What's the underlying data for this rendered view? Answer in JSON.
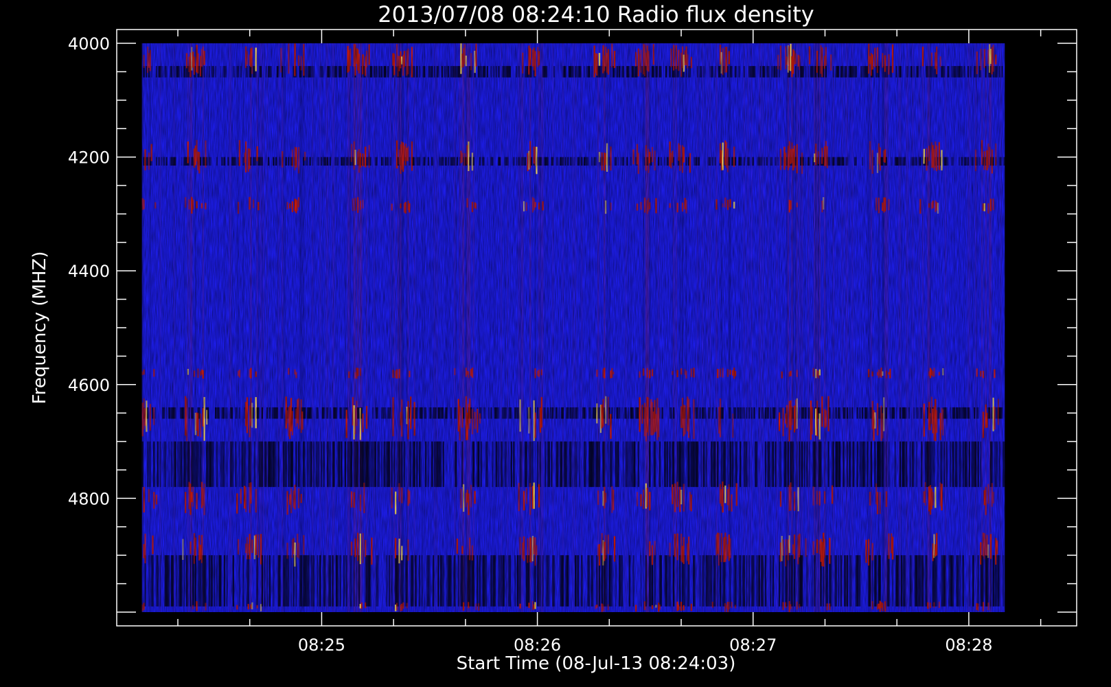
{
  "chart_data": {
    "type": "heatmap",
    "title": "2013/07/08 08:24:10 Radio flux density",
    "xlabel": "Start Time (08-Jul-13 08:24:03)",
    "ylabel": "Frequency (MHZ)",
    "xlim": [
      "08:24:03",
      "08:28:30"
    ],
    "ylim": [
      4000,
      5000
    ],
    "y_inverted": true,
    "data_extent": {
      "time": [
        "08:24:10",
        "08:28:10"
      ],
      "frequency": [
        4000,
        5000
      ]
    },
    "x_ticks": [
      "08:25",
      "08:26",
      "08:27",
      "08:28"
    ],
    "y_ticks": [
      4000,
      4200,
      4400,
      4600,
      4800
    ],
    "colormap": [
      "#000000",
      "#1e1ef0",
      "#d01c08",
      "#ffe060"
    ],
    "background_color": "#000000",
    "grid": false,
    "legend": "none"
  }
}
